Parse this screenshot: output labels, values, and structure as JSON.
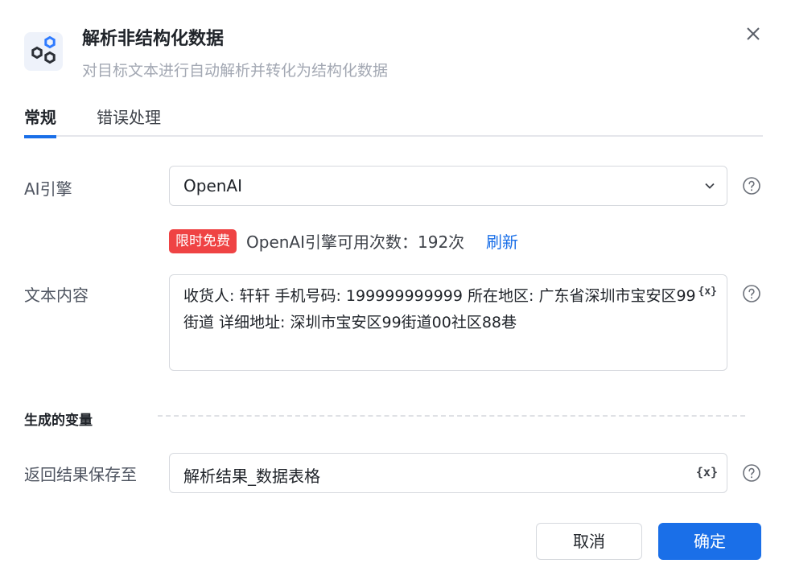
{
  "dialog": {
    "title": "解析非结构化数据",
    "subtitle": "对目标文本进行自动解析并转化为结构化数据",
    "close_icon": "close-icon",
    "app_icon": "hexagon-nodes-icon"
  },
  "tabs": [
    {
      "label": "常规",
      "active": true
    },
    {
      "label": "错误处理",
      "active": false
    }
  ],
  "form": {
    "engine": {
      "label": "AI引擎",
      "value": "OpenAI",
      "icon": "chevron-down-icon"
    },
    "quota": {
      "badge": "限时免费",
      "text": "OpenAI引擎可用次数：192次",
      "refresh": "刷新"
    },
    "content": {
      "label": "文本内容",
      "value": "收货人: 轩轩  手机号码:  199999999999  所在地区: 广东省深圳市宝安区99街道 详细地址: 深圳市宝安区99街道00社区88巷",
      "var_icon": "{x}"
    },
    "section": {
      "title": "生成的变量"
    },
    "result": {
      "label": "返回结果保存至",
      "value": "解析结果_数据表格",
      "var_icon": "{x}"
    }
  },
  "footer": {
    "cancel": "取消",
    "ok": "确定"
  },
  "colors": {
    "primary": "#1a6fe8",
    "badge": "#ef4344",
    "border": "#d6d9de"
  }
}
